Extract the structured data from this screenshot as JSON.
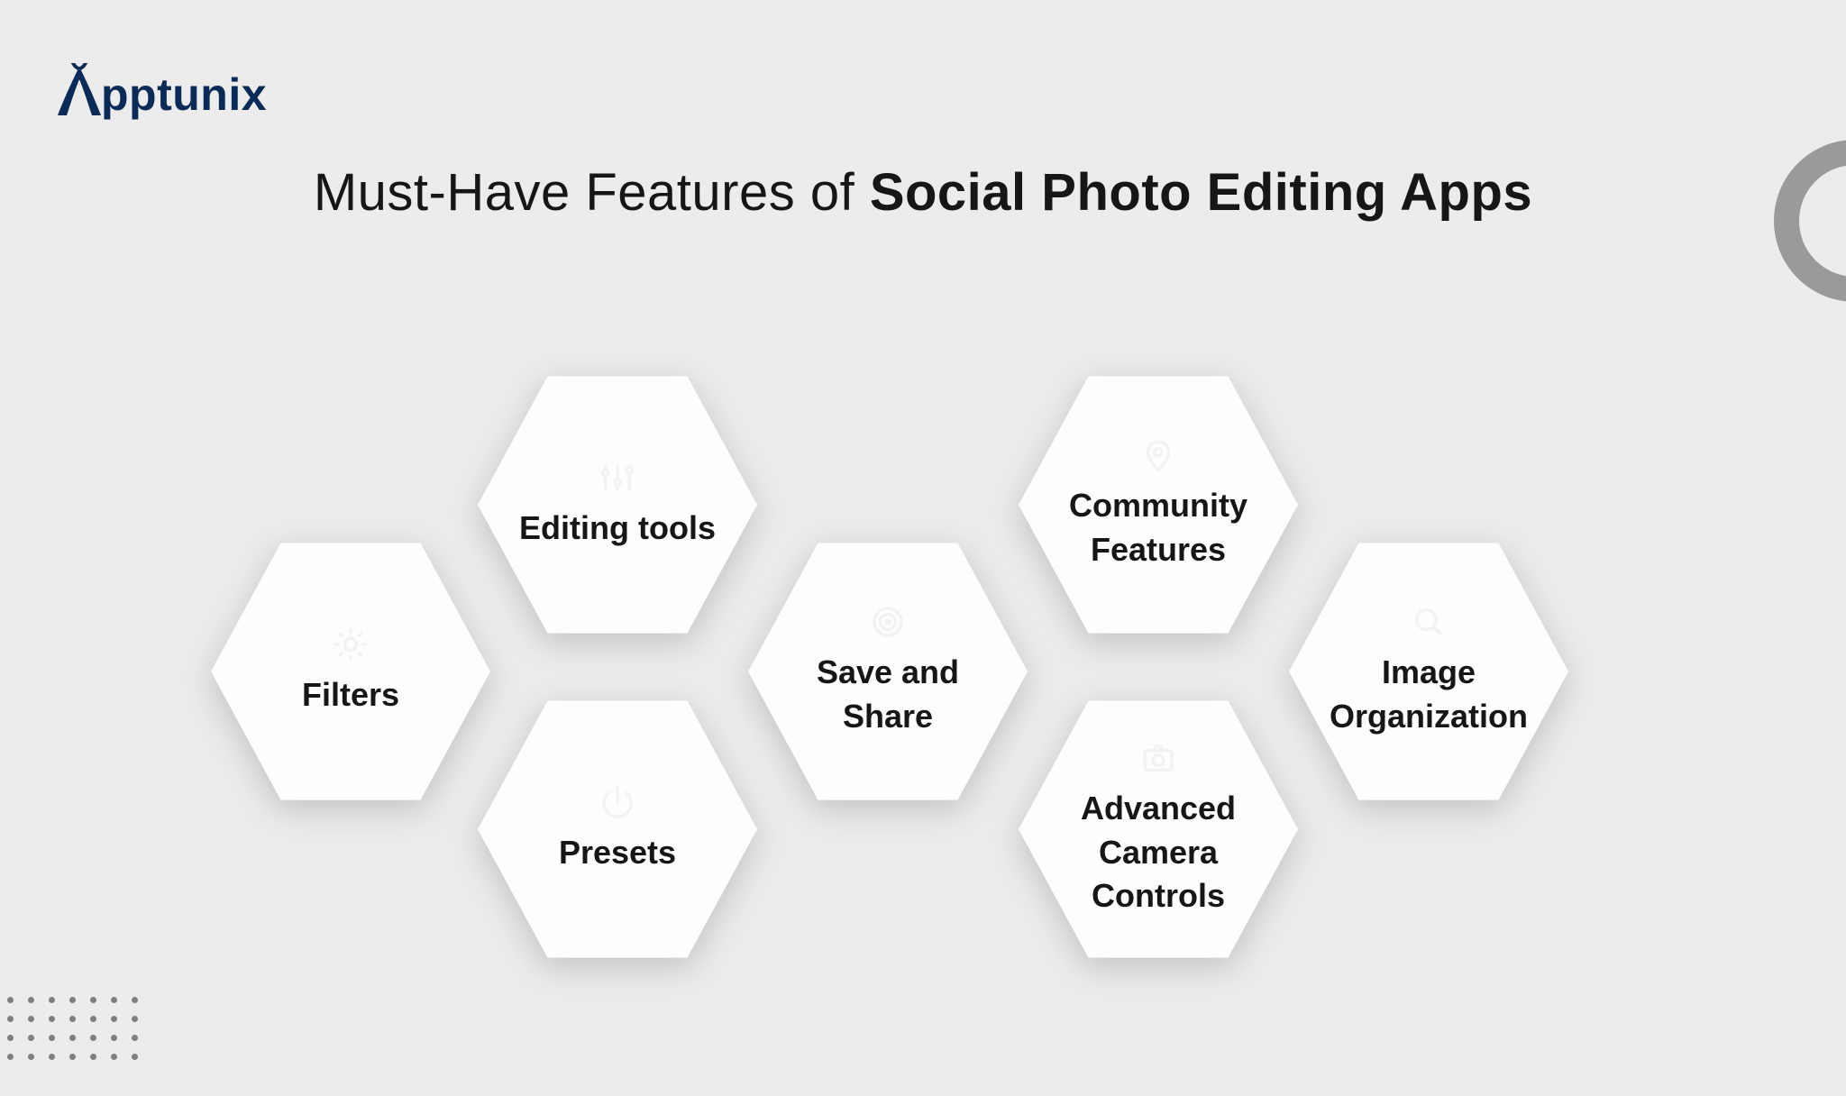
{
  "brand": {
    "name": "pptunix"
  },
  "heading": {
    "prefix": "Must-Have Features of ",
    "emphasis": "Social Photo Editing Apps"
  },
  "features": {
    "filters": {
      "label": "Filters",
      "icon": "sun"
    },
    "editing_tools": {
      "label": "Editing tools",
      "icon": "sliders"
    },
    "presets": {
      "label": "Presets",
      "icon": "power"
    },
    "save_share": {
      "label": "Save and Share",
      "icon": "target"
    },
    "community": {
      "label": "Community Features",
      "icon": "pin"
    },
    "adv_camera": {
      "label": "Advanced Camera Controls",
      "icon": "camera"
    },
    "image_org": {
      "label": "Image Organization",
      "icon": "search"
    }
  }
}
